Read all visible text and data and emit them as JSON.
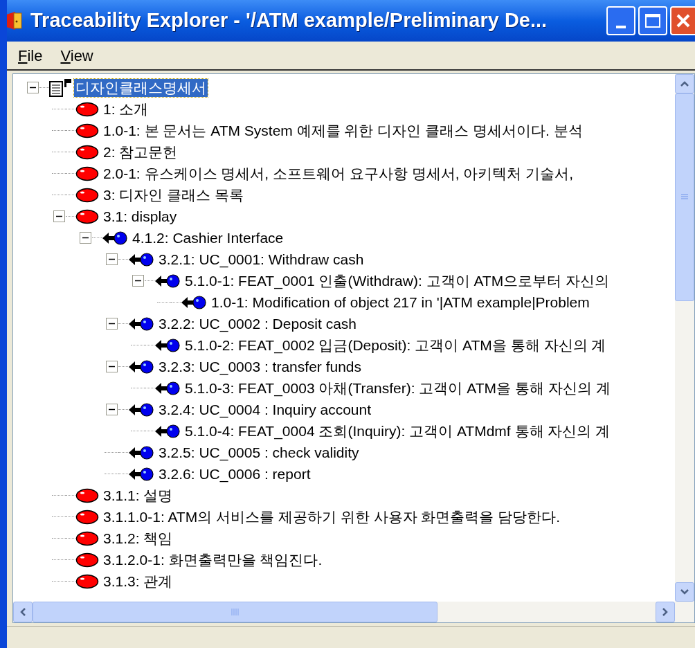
{
  "window": {
    "title": "Traceability Explorer - '/ATM example/Preliminary De..."
  },
  "menu": [
    {
      "label": "File"
    },
    {
      "label": "View"
    }
  ],
  "tree": [
    {
      "label": "디자인클래스명세서",
      "kind": "document",
      "selected": true,
      "expanded": true,
      "children": [
        {
          "label": "1: 소개",
          "kind": "section",
          "selected": false
        },
        {
          "label": "1.0-1: 본 문서는 ATM System 예제를 위한 디자인 클래스 명세서이다. 분석",
          "kind": "section",
          "selected": false
        },
        {
          "label": "2: 참고문헌",
          "kind": "section",
          "selected": false
        },
        {
          "label": "2.0-1:  유스케이스 명세서, 소프트웨어 요구사항 명세서, 아키텍처 기술서,",
          "kind": "section",
          "selected": false
        },
        {
          "label": "3: 디자인 클래스 목록",
          "kind": "section",
          "selected": false
        },
        {
          "label": "3.1: display",
          "kind": "section",
          "selected": false,
          "expanded": true,
          "children": [
            {
              "label": "4.1.2: Cashier Interface",
              "kind": "link",
              "selected": false,
              "expanded": true,
              "children": [
                {
                  "label": "3.2.1: UC_0001: Withdraw cash",
                  "kind": "link",
                  "selected": false,
                  "expanded": true,
                  "children": [
                    {
                      "label": "5.1.0-1: FEAT_0001 인출(Withdraw): 고객이 ATM으로부터 자신의",
                      "kind": "link",
                      "selected": false,
                      "expanded": true,
                      "children": [
                        {
                          "label": "1.0-1: Modification of object 217 in '|ATM example|Problem",
                          "kind": "link",
                          "selected": false
                        }
                      ]
                    }
                  ]
                },
                {
                  "label": "3.2.2: UC_0002 : Deposit cash",
                  "kind": "link",
                  "selected": false,
                  "expanded": true,
                  "children": [
                    {
                      "label": "5.1.0-2: FEAT_0002 입금(Deposit): 고객이 ATM을 통해 자신의 계",
                      "kind": "link",
                      "selected": false
                    }
                  ]
                },
                {
                  "label": "3.2.3: UC_0003 : transfer funds",
                  "kind": "link",
                  "selected": false,
                  "expanded": true,
                  "children": [
                    {
                      "label": "5.1.0-3: FEAT_0003 아채(Transfer): 고객이 ATM을 통해 자신의 계",
                      "kind": "link",
                      "selected": false
                    }
                  ]
                },
                {
                  "label": "3.2.4: UC_0004 : Inquiry account",
                  "kind": "link",
                  "selected": false,
                  "expanded": true,
                  "children": [
                    {
                      "label": "5.1.0-4: FEAT_0004 조회(Inquiry): 고객이 ATMdmf 통해 자신의 계",
                      "kind": "link",
                      "selected": false
                    }
                  ]
                },
                {
                  "label": "3.2.5: UC_0005 : check validity",
                  "kind": "link",
                  "selected": false
                },
                {
                  "label": "3.2.6: UC_0006 : report",
                  "kind": "link",
                  "selected": false
                }
              ]
            }
          ]
        },
        {
          "label": "3.1.1: 설명",
          "kind": "section",
          "selected": false
        },
        {
          "label": "3.1.1.0-1: ATM의 서비스를 제공하기 위한 사용자 화면출력을 담당한다.",
          "kind": "section",
          "selected": false
        },
        {
          "label": "3.1.2: 책임",
          "kind": "section",
          "selected": false
        },
        {
          "label": "3.1.2.0-1:  화면출력만을 책임진다.",
          "kind": "section",
          "selected": false
        },
        {
          "label": "3.1.3: 관계",
          "kind": "section",
          "selected": false
        }
      ]
    }
  ]
}
